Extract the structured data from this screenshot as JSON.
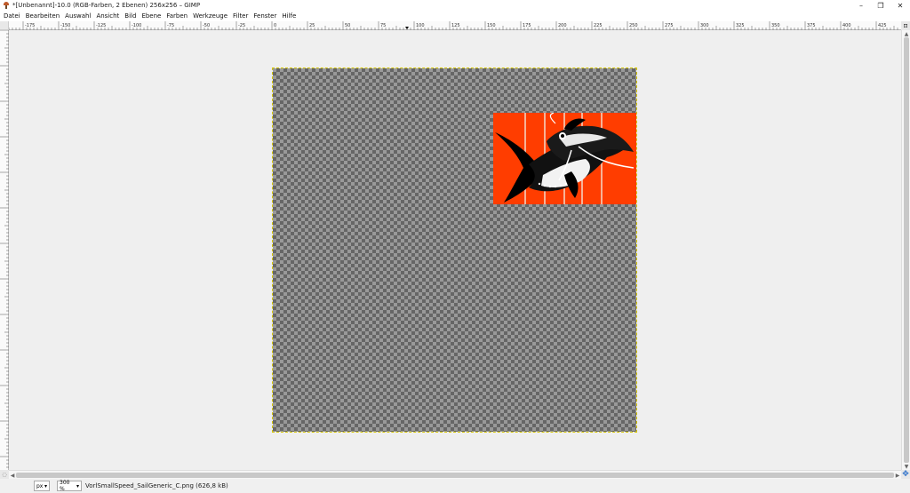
{
  "window": {
    "title": "*[Unbenannt]-10.0 (RGB-Farben, 2 Ebenen) 256x256 – GIMP",
    "minimize": "–",
    "maximize": "❐",
    "close": "✕"
  },
  "menu": {
    "items": [
      "Datei",
      "Bearbeiten",
      "Auswahl",
      "Ansicht",
      "Bild",
      "Ebene",
      "Farben",
      "Werkzeuge",
      "Filter",
      "Fenster",
      "Hilfe"
    ]
  },
  "ruler": {
    "h_labels": [
      "-175",
      "-150",
      "-125",
      "-100",
      "-75",
      "-50",
      "-25",
      "0",
      "25",
      "50",
      "75",
      "100",
      "125",
      "150",
      "175",
      "200",
      "225",
      "250",
      "275",
      "300",
      "325",
      "350",
      "375",
      "400",
      "425"
    ]
  },
  "statusbar": {
    "unit": "px",
    "zoom": "300 %",
    "message": "VorlSmallSpeed_SailGeneric_C.png (626,8 kB)"
  },
  "colors": {
    "layer_fill": "#ff3d00",
    "boundary": "#d4c400"
  }
}
